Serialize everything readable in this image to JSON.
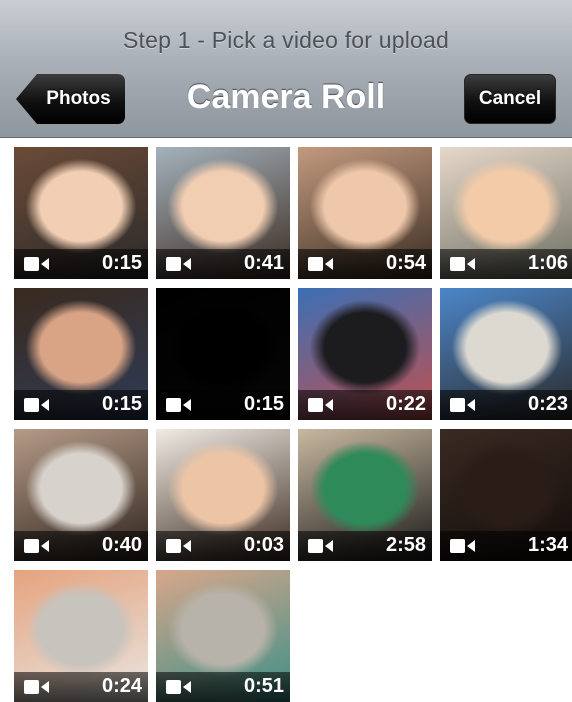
{
  "header": {
    "prompt": "Step 1 - Pick a video for upload",
    "title": "Camera Roll",
    "back_label": "Photos",
    "cancel_label": "Cancel"
  },
  "videos": [
    {
      "duration": "0:15",
      "icon": "video-camera-icon",
      "colors": [
        "#f2cfb4",
        "#2a2a2a",
        "#6b4b37"
      ]
    },
    {
      "duration": "0:41",
      "icon": "video-camera-icon",
      "colors": [
        "#f1cdb2",
        "#3a2a20",
        "#a4b2bc"
      ]
    },
    {
      "duration": "0:54",
      "icon": "video-camera-icon",
      "colors": [
        "#efc8ab",
        "#3a2c22",
        "#c29a7f"
      ]
    },
    {
      "duration": "1:06",
      "icon": "video-camera-icon",
      "colors": [
        "#f3cba9",
        "#6d6f62",
        "#e6d8ca"
      ]
    },
    {
      "duration": "0:15",
      "icon": "video-camera-icon",
      "colors": [
        "#d9a486",
        "#2d3b56",
        "#3a2a1e"
      ]
    },
    {
      "duration": "0:15",
      "icon": "video-camera-icon",
      "colors": [
        "#000000",
        "#050505",
        "#000000"
      ]
    },
    {
      "duration": "0:22",
      "icon": "video-camera-icon",
      "colors": [
        "#1c1c1e",
        "#c0504d",
        "#3c6fb5"
      ]
    },
    {
      "duration": "0:23",
      "icon": "video-camera-icon",
      "colors": [
        "#dcd9d1",
        "#2a2a2a",
        "#4c86c9"
      ]
    },
    {
      "duration": "0:40",
      "icon": "video-camera-icon",
      "colors": [
        "#d7d2cc",
        "#2e231d",
        "#b59b87"
      ]
    },
    {
      "duration": "0:03",
      "icon": "video-camera-icon",
      "colors": [
        "#ecc5a6",
        "#3c2b20",
        "#f0ebe4"
      ]
    },
    {
      "duration": "2:58",
      "icon": "video-camera-icon",
      "colors": [
        "#2f8a5a",
        "#1a1a1a",
        "#c8b8a0"
      ]
    },
    {
      "duration": "1:34",
      "icon": "video-camera-icon",
      "colors": [
        "#2a1d18",
        "#120c0a",
        "#3a2a22"
      ]
    },
    {
      "duration": "0:24",
      "icon": "video-camera-icon",
      "colors": [
        "#c7c3bd",
        "#e9e6e2",
        "#e5a37e"
      ]
    },
    {
      "duration": "0:51",
      "icon": "video-camera-icon",
      "colors": [
        "#b8b3aa",
        "#3c8f88",
        "#d7a78a"
      ]
    }
  ]
}
